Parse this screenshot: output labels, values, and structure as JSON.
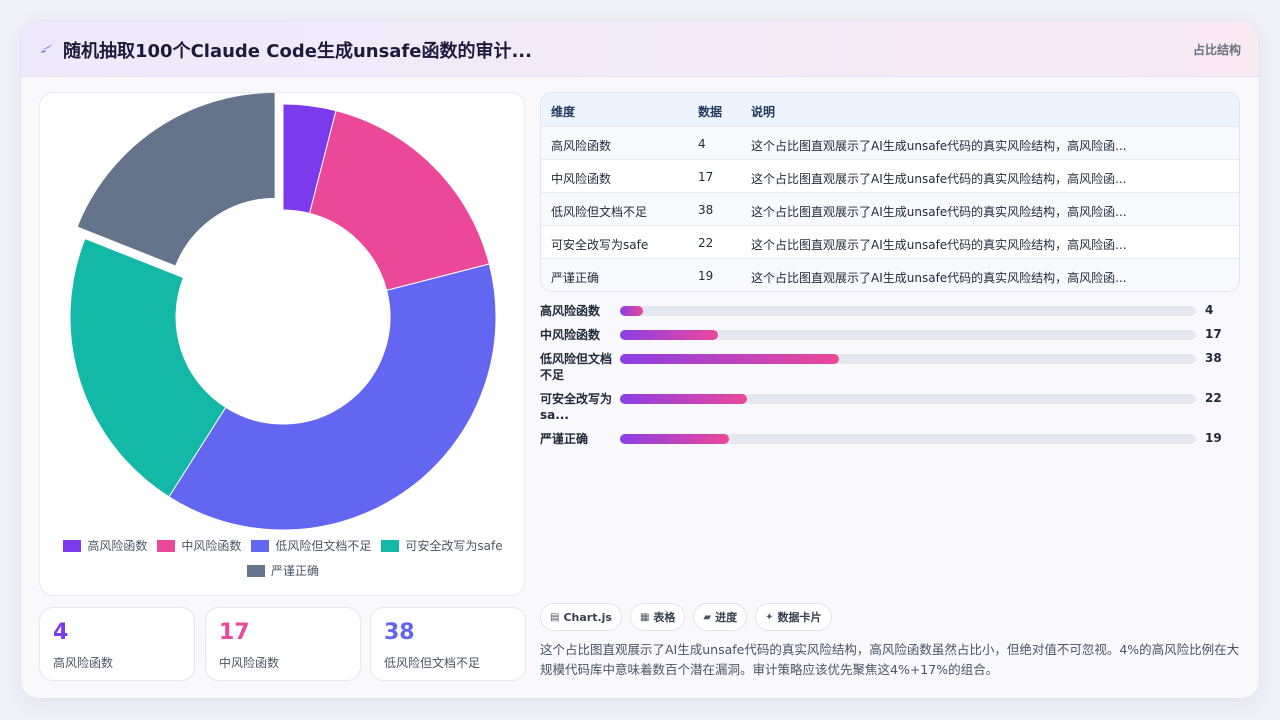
{
  "header": {
    "title": "随机抽取100个Claude Code生成unsafe函数的审计...",
    "icon": "sparkle-icon",
    "tag": "占比结构"
  },
  "chart_data": {
    "type": "pie",
    "categories": [
      "高风险函数",
      "中风险函数",
      "低风险但文档不足",
      "可安全改写为safe",
      "严谨正确"
    ],
    "values": [
      4,
      17,
      38,
      22,
      19
    ],
    "colors": [
      "#7c3aed",
      "#ec4899",
      "#6366f1",
      "#14b8a6",
      "#64748b"
    ],
    "title": "",
    "legend_position": "bottom"
  },
  "legend": [
    {
      "label": "高风险函数",
      "color": "#7c3aed"
    },
    {
      "label": "中风险函数",
      "color": "#ec4899"
    },
    {
      "label": "低风险但文档不足",
      "color": "#6366f1"
    },
    {
      "label": "可安全改写为safe",
      "color": "#14b8a6"
    },
    {
      "label": "严谨正确",
      "color": "#64748b"
    }
  ],
  "kpis": [
    {
      "value": "4",
      "label": "高风险函数",
      "color": "#7c3aed"
    },
    {
      "value": "17",
      "label": "中风险函数",
      "color": "#ec4899"
    },
    {
      "value": "38",
      "label": "低风险但文档不足",
      "color": "#6366f1"
    }
  ],
  "table": {
    "headers": [
      "维度",
      "数据",
      "说明"
    ],
    "rows": [
      [
        "高风险函数",
        "4",
        "这个占比图直观展示了AI生成unsafe代码的真实风险结构，高风险函..."
      ],
      [
        "中风险函数",
        "17",
        "这个占比图直观展示了AI生成unsafe代码的真实风险结构，高风险函..."
      ],
      [
        "低风险但文档不足",
        "38",
        "这个占比图直观展示了AI生成unsafe代码的真实风险结构，高风险函..."
      ],
      [
        "可安全改写为safe",
        "22",
        "这个占比图直观展示了AI生成unsafe代码的真实风险结构，高风险函..."
      ],
      [
        "严谨正确",
        "19",
        "这个占比图直观展示了AI生成unsafe代码的真实风险结构，高风险函..."
      ]
    ]
  },
  "progress": [
    {
      "label": "高风险函数",
      "value": "4",
      "percent": 4
    },
    {
      "label": "中风险函数",
      "value": "17",
      "percent": 17
    },
    {
      "label": "低风险但文档不足",
      "value": "38",
      "percent": 38
    },
    {
      "label": "可安全改写为sa...",
      "value": "22",
      "percent": 22
    },
    {
      "label": "严谨正确",
      "value": "19",
      "percent": 19
    }
  ],
  "chips": [
    {
      "label": "Chart.js",
      "icon": "chart-icon",
      "glyph": "▤"
    },
    {
      "label": "表格",
      "icon": "table-icon",
      "glyph": "▦"
    },
    {
      "label": "进度",
      "icon": "progress-icon",
      "glyph": "▰"
    },
    {
      "label": "数据卡片",
      "icon": "card-icon",
      "glyph": "✦"
    }
  ],
  "summary": "这个占比图直观展示了AI生成unsafe代码的真实风险结构，高风险函数虽然占比小，但绝对值不可忽视。4%的高风险比例在大规模代码库中意味着数百个潜在漏洞。审计策略应该优先聚焦这4%+17%的组合。"
}
